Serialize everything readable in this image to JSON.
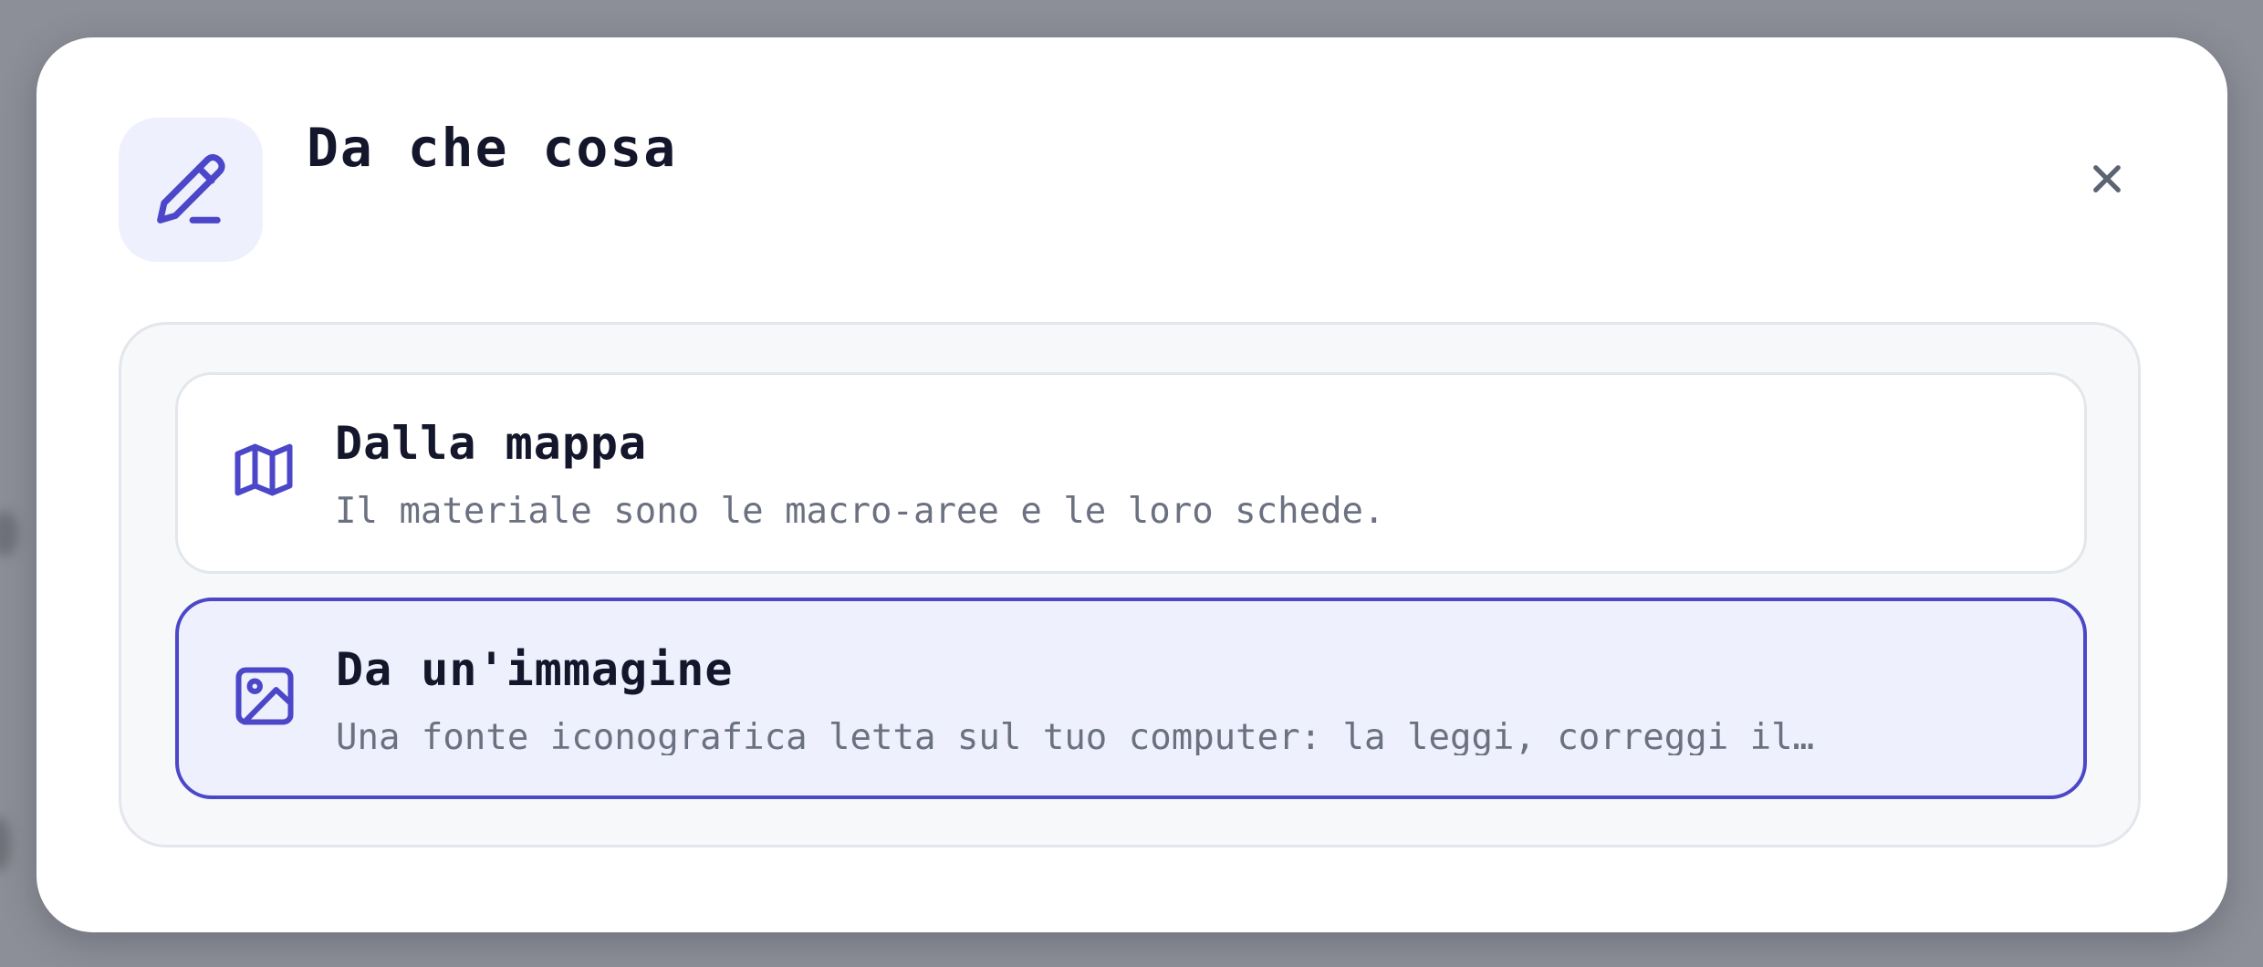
{
  "dialog": {
    "title": "Da che cosa",
    "header_icon": "pencil-icon",
    "close_icon": "close-icon"
  },
  "options": [
    {
      "title": "Dalla mappa",
      "description": "Il materiale sono le macro-aree e le loro schede.",
      "icon": "map-icon",
      "selected": false
    },
    {
      "title": "Da un'immagine",
      "description": "Una fonte iconografica letta sul tuo computer: la leggi, correggi il…",
      "icon": "image-icon",
      "selected": true
    }
  ],
  "colors": {
    "accent": "#4b47c8",
    "accent_light": "#eef0fd",
    "text_dark": "#14172b",
    "text_muted": "#6b7180",
    "backdrop": "#8d8f98"
  }
}
